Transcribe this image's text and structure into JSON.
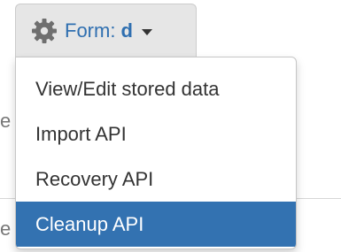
{
  "form_toggle": {
    "icon": "gear-icon",
    "label_prefix": "Form:",
    "form_name": "d"
  },
  "dropdown": {
    "items": [
      {
        "label": "View/Edit stored data",
        "active": false
      },
      {
        "label": "Import API",
        "active": false
      },
      {
        "label": "Recovery API",
        "active": false
      },
      {
        "label": "Cleanup API",
        "active": true
      }
    ],
    "highlight_color": "#3372b1"
  },
  "background": {
    "fragment_1": "e",
    "fragment_2": "e"
  }
}
